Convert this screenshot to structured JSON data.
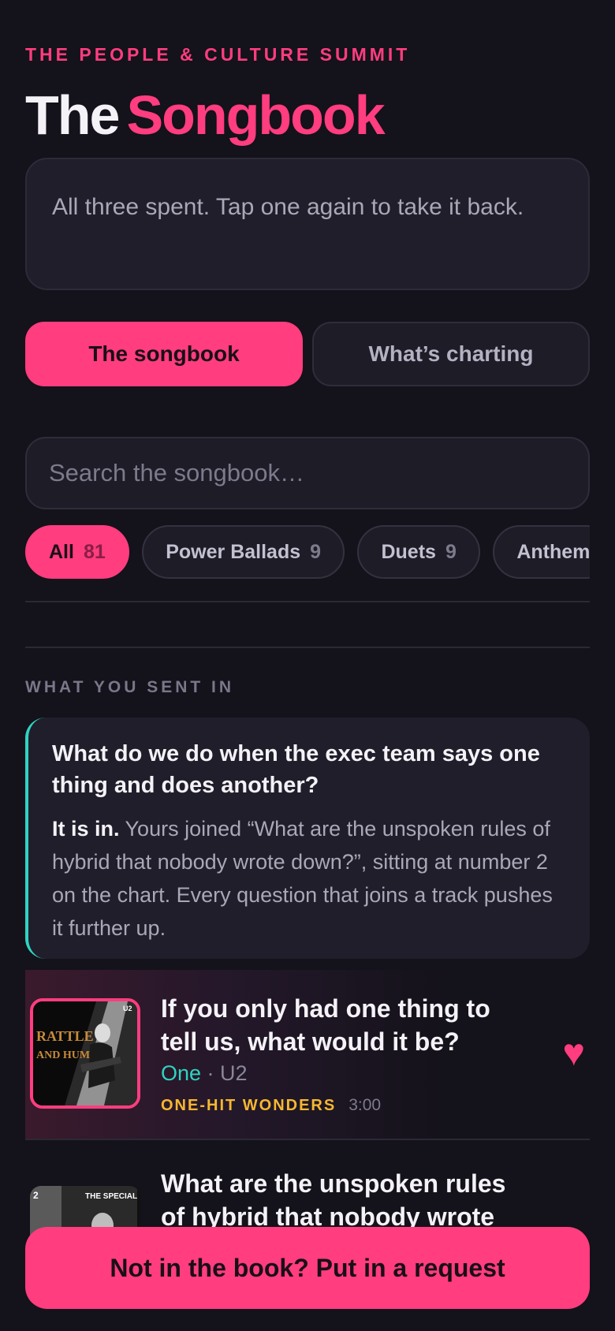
{
  "header": {
    "eyebrow": "THE PEOPLE & CULTURE SUMMIT",
    "title_part1": "The",
    "title_part2": "Songbook"
  },
  "notice": {
    "text": "All three spent. Tap one again to take it back."
  },
  "tabs": [
    {
      "label": "The songbook",
      "active": true
    },
    {
      "label": "What’s charting",
      "active": false
    }
  ],
  "search": {
    "placeholder": "Search the songbook…"
  },
  "filters": [
    {
      "label": "All",
      "count": "81",
      "active": true
    },
    {
      "label": "Power Ballads",
      "count": "9",
      "active": false
    },
    {
      "label": "Duets",
      "count": "9",
      "active": false
    },
    {
      "label": "Anthem",
      "count": "",
      "active": false
    }
  ],
  "sent_section": {
    "label": "WHAT YOU SENT IN",
    "question": "What do we do when the exec team says one thing and does another?",
    "lead": "It is in.",
    "body": " Yours joined “What are the unspoken rules of hybrid that nobody wrote down?”, sitting at number 2 on the chart. Every question that joins a track pushes it further up."
  },
  "songs": [
    {
      "question": "If you only had one thing to tell us, what would it be?",
      "track": "One",
      "separator": " · ",
      "artist": "U2",
      "genre": "ONE-HIT WONDERS",
      "duration": "3:00",
      "cover_text_main": "RATTLE",
      "cover_text_sub": "AND HUM",
      "cover_corner": "U2",
      "liked": true
    },
    {
      "question": "What are the unspoken rules of hybrid that nobody wrote down?",
      "cover_text_main": "THE SPECIALS",
      "cover_corner": "2"
    }
  ],
  "cta": {
    "label": "Not in the book? Put in a request"
  },
  "colors": {
    "background": "#14121a",
    "accent": "#ff3d7f",
    "teal": "#2fd4c0",
    "genre": "#f6b731"
  }
}
